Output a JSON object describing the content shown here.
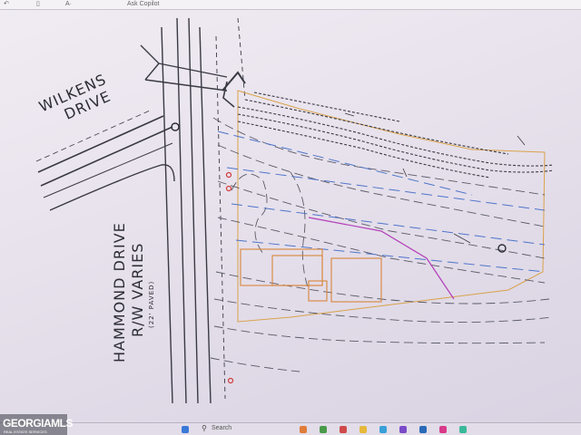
{
  "toolbar": {
    "items": [
      "A·",
      "Ask Copilot"
    ]
  },
  "plan": {
    "streets": {
      "wilkens_line1": "WILKENS",
      "wilkens_line2": "DRIVE",
      "hammond_line1": "HAMMOND DRIVE",
      "hammond_line2": "R/W VARIES",
      "hammond_note": "(22' PAVED)"
    }
  },
  "taskbar": {
    "search_label": "Search"
  },
  "watermark": {
    "brand": "GEORGIAMLS",
    "tagline": "REAL ESTATE SERVICES"
  },
  "colors": {
    "screen_background": "#e9e4ee",
    "linework": "#3a3a44",
    "contours": "#5a5a66",
    "blue_dash": "#4e74c9",
    "orange_building": "#d9853a",
    "magenta_line": "#b33fb8",
    "red_markers": "#d23a3a"
  }
}
